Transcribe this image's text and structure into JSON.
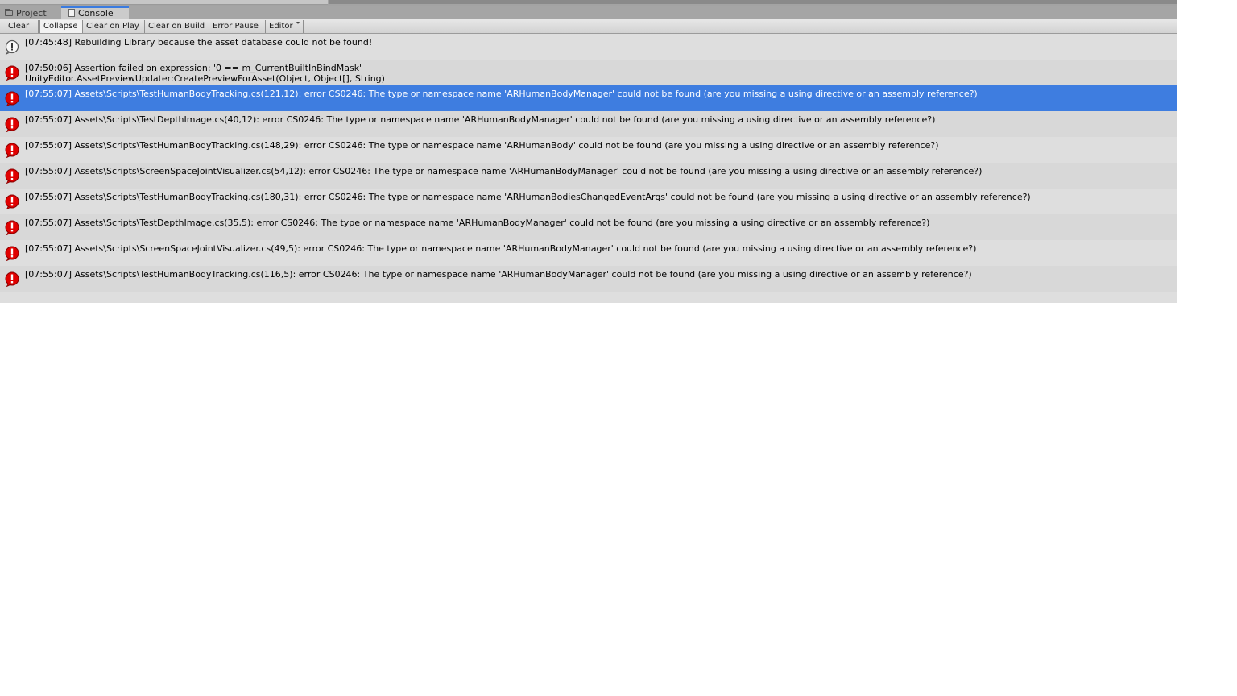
{
  "tabs": [
    {
      "label": "Project",
      "icon": "folder-icon"
    },
    {
      "label": "Console",
      "icon": "console-icon"
    }
  ],
  "toolbar": {
    "clear": "Clear",
    "collapse": "Collapse",
    "clear_on_play": "Clear on Play",
    "clear_on_build": "Clear on Build",
    "error_pause": "Error Pause",
    "editor": "Editor"
  },
  "colors": {
    "selection": "#3e7de0",
    "error": "#e00000"
  },
  "logs": [
    {
      "type": "warning",
      "icon": "warning-icon",
      "line1": "[07:45:48] Rebuilding Library because the asset database could not be found!",
      "line2": ""
    },
    {
      "type": "error",
      "icon": "error-icon",
      "line1": "[07:50:06] Assertion failed on expression: '0 == m_CurrentBuiltInBindMask'",
      "line2": "UnityEditor.AssetPreviewUpdater:CreatePreviewForAsset(Object, Object[], String)"
    },
    {
      "type": "error",
      "icon": "error-icon",
      "selected": true,
      "line1": "[07:55:07] Assets\\Scripts\\TestHumanBodyTracking.cs(121,12): error CS0246: The type or namespace name 'ARHumanBodyManager' could not be found (are you missing a using directive or an assembly reference?)",
      "line2": ""
    },
    {
      "type": "error",
      "icon": "error-icon",
      "line1": "[07:55:07] Assets\\Scripts\\TestDepthImage.cs(40,12): error CS0246: The type or namespace name 'ARHumanBodyManager' could not be found (are you missing a using directive or an assembly reference?)",
      "line2": ""
    },
    {
      "type": "error",
      "icon": "error-icon",
      "line1": "[07:55:07] Assets\\Scripts\\TestHumanBodyTracking.cs(148,29): error CS0246: The type or namespace name 'ARHumanBody' could not be found (are you missing a using directive or an assembly reference?)",
      "line2": ""
    },
    {
      "type": "error",
      "icon": "error-icon",
      "line1": "[07:55:07] Assets\\Scripts\\ScreenSpaceJointVisualizer.cs(54,12): error CS0246: The type or namespace name 'ARHumanBodyManager' could not be found (are you missing a using directive or an assembly reference?)",
      "line2": ""
    },
    {
      "type": "error",
      "icon": "error-icon",
      "line1": "[07:55:07] Assets\\Scripts\\TestHumanBodyTracking.cs(180,31): error CS0246: The type or namespace name 'ARHumanBodiesChangedEventArgs' could not be found (are you missing a using directive or an assembly reference?)",
      "line2": ""
    },
    {
      "type": "error",
      "icon": "error-icon",
      "line1": "[07:55:07] Assets\\Scripts\\TestDepthImage.cs(35,5): error CS0246: The type or namespace name 'ARHumanBodyManager' could not be found (are you missing a using directive or an assembly reference?)",
      "line2": ""
    },
    {
      "type": "error",
      "icon": "error-icon",
      "line1": "[07:55:07] Assets\\Scripts\\ScreenSpaceJointVisualizer.cs(49,5): error CS0246: The type or namespace name 'ARHumanBodyManager' could not be found (are you missing a using directive or an assembly reference?)",
      "line2": ""
    },
    {
      "type": "error",
      "icon": "error-icon",
      "line1": "[07:55:07] Assets\\Scripts\\TestHumanBodyTracking.cs(116,5): error CS0246: The type or namespace name 'ARHumanBodyManager' could not be found (are you missing a using directive or an assembly reference?)",
      "line2": ""
    }
  ]
}
